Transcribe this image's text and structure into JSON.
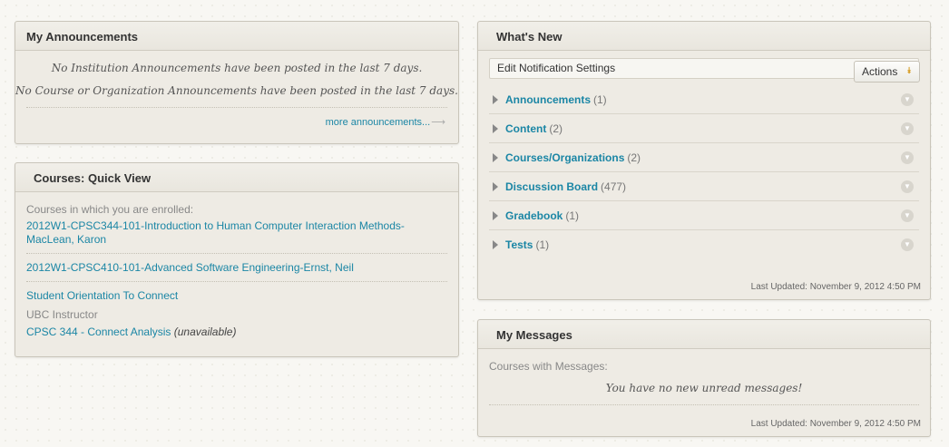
{
  "announcements": {
    "title": "My Announcements",
    "institution_msg": "No Institution Announcements have been posted in the last 7 days.",
    "course_msg": "No Course or Organization Announcements have been posted in the last 7 days.",
    "more_link": "more announcements...",
    "more_arrow": "⟶"
  },
  "courses": {
    "title": "Courses: Quick View",
    "enrolled_label": "Courses in which you are enrolled:",
    "items": [
      {
        "label": "2012W1-CPSC344-101-Introduction to Human Computer Interaction Methods-MacLean, Karon"
      },
      {
        "label": "2012W1-CPSC410-101-Advanced Software Engineering-Ernst, Neil"
      },
      {
        "label": "Student Orientation To Connect"
      }
    ],
    "instructor_label": "UBC Instructor",
    "instructor_course": "CPSC 344 - Connect Analysis",
    "instructor_status": "(unavailable)"
  },
  "whats_new": {
    "title": "What's New",
    "notification_settings": "Edit Notification Settings",
    "actions_label": "Actions",
    "actions_icon": "double-chevron-down-icon",
    "items": [
      {
        "label": "Announcements",
        "count": "(1)"
      },
      {
        "label": "Content",
        "count": "(2)"
      },
      {
        "label": "Courses/Organizations",
        "count": "(2)"
      },
      {
        "label": "Discussion Board",
        "count": "(477)"
      },
      {
        "label": "Gradebook",
        "count": "(1)"
      },
      {
        "label": "Tests",
        "count": "(1)"
      }
    ],
    "last_updated": "Last Updated: November 9, 2012 4:50 PM"
  },
  "messages": {
    "title": "My Messages",
    "courses_label": "Courses with Messages:",
    "none_msg": "You have no new unread messages!",
    "last_updated": "Last Updated: November 9, 2012 4:50 PM"
  },
  "colors": {
    "link": "#1b86a5",
    "accent": "#d69a1d"
  }
}
